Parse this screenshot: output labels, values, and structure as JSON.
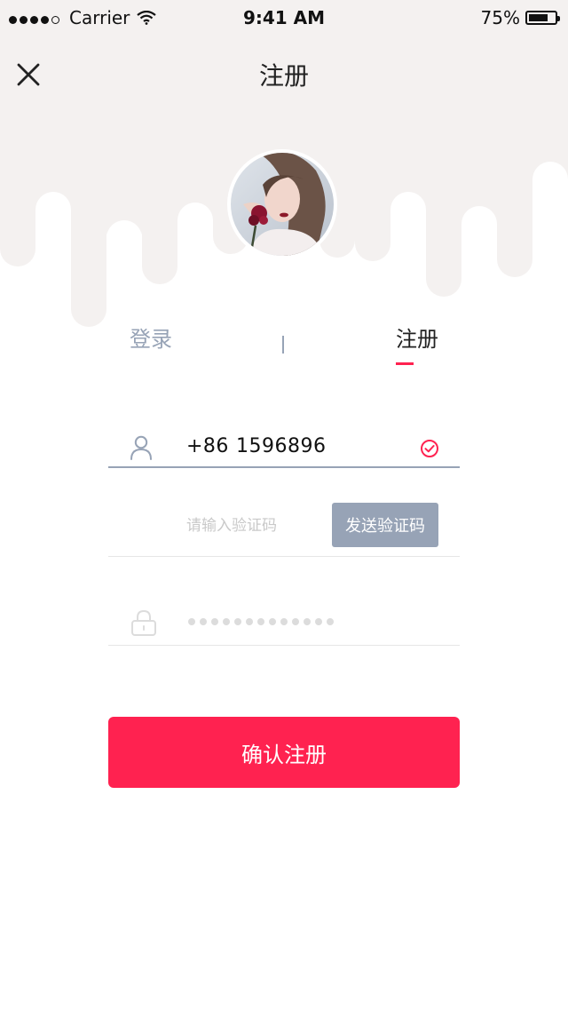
{
  "status_bar": {
    "carrier": "Carrier",
    "time": "9:41 AM",
    "battery_percent": "75%",
    "battery_level": 0.75
  },
  "header": {
    "title": "注册",
    "close_icon": "close-icon"
  },
  "tabs": {
    "login_label": "登录",
    "register_label": "注册",
    "active": "register"
  },
  "form": {
    "phone": {
      "country_code": "+86",
      "value": "1596896",
      "valid": true,
      "icon": "user-icon"
    },
    "verification": {
      "placeholder": "请输入验证码",
      "value": "",
      "send_button_label": "发送验证码"
    },
    "password": {
      "icon": "lock-icon",
      "masked_length": 13
    }
  },
  "confirm_button_label": "确认注册",
  "colors": {
    "accent": "#ff2250",
    "muted_blue": "#97a3b6",
    "header_bg": "#f4f1f0"
  }
}
